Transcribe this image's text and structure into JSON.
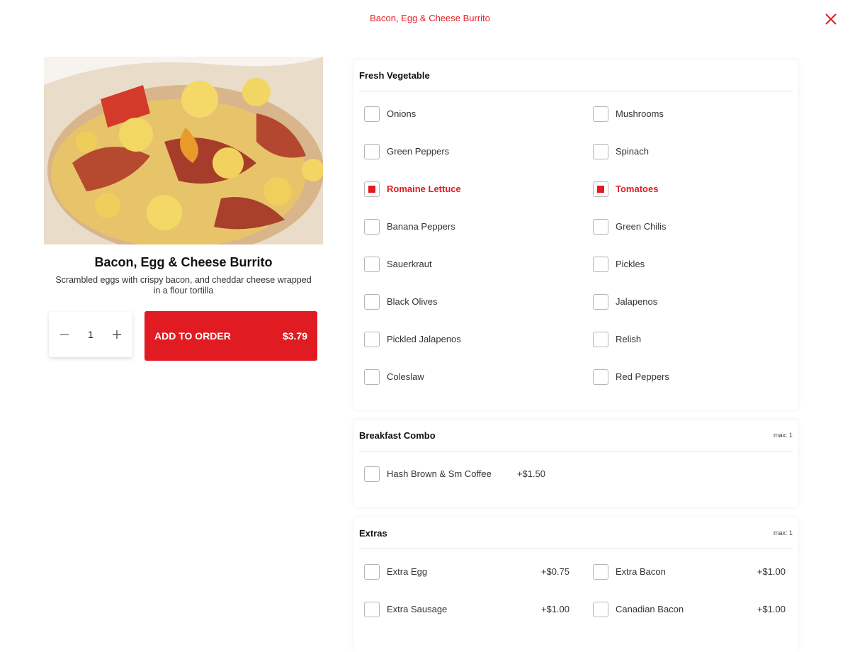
{
  "modal": {
    "title": "Bacon, Egg & Cheese Burrito"
  },
  "product": {
    "name": "Bacon, Egg & Cheese Burrito",
    "description": "Scrambled eggs with crispy bacon, and cheddar cheese wrapped in a flour tortilla",
    "quantity": "1",
    "add_label": "ADD TO ORDER",
    "price": "$3.79"
  },
  "colors": {
    "accent": "#e01b22"
  },
  "groups": [
    {
      "title": "Fresh Vegetable",
      "max": "",
      "options": [
        {
          "label": "Onions",
          "checked": false
        },
        {
          "label": "Mushrooms",
          "checked": false
        },
        {
          "label": "Green Peppers",
          "checked": false
        },
        {
          "label": "Spinach",
          "checked": false
        },
        {
          "label": "Romaine Lettuce",
          "checked": true
        },
        {
          "label": "Tomatoes",
          "checked": true
        },
        {
          "label": "Banana Peppers",
          "checked": false
        },
        {
          "label": "Green Chilis",
          "checked": false
        },
        {
          "label": "Sauerkraut",
          "checked": false
        },
        {
          "label": "Pickles",
          "checked": false
        },
        {
          "label": "Black Olives",
          "checked": false
        },
        {
          "label": "Jalapenos",
          "checked": false
        },
        {
          "label": "Pickled Jalapenos",
          "checked": false
        },
        {
          "label": "Relish",
          "checked": false
        },
        {
          "label": "Coleslaw",
          "checked": false
        },
        {
          "label": "Red Peppers",
          "checked": false
        }
      ]
    },
    {
      "title": "Breakfast Combo",
      "max": "max: 1",
      "options": [
        {
          "label": "Hash Brown & Sm Coffee",
          "price": "+$1.50",
          "checked": false
        }
      ]
    },
    {
      "title": "Extras",
      "max": "max: 1",
      "options": [
        {
          "label": "Extra Egg",
          "price": "+$0.75",
          "checked": false
        },
        {
          "label": "Extra Bacon",
          "price": "+$1.00",
          "checked": false
        },
        {
          "label": "Extra Sausage",
          "price": "+$1.00",
          "checked": false
        },
        {
          "label": "Canadian Bacon",
          "price": "+$1.00",
          "checked": false
        }
      ]
    }
  ]
}
